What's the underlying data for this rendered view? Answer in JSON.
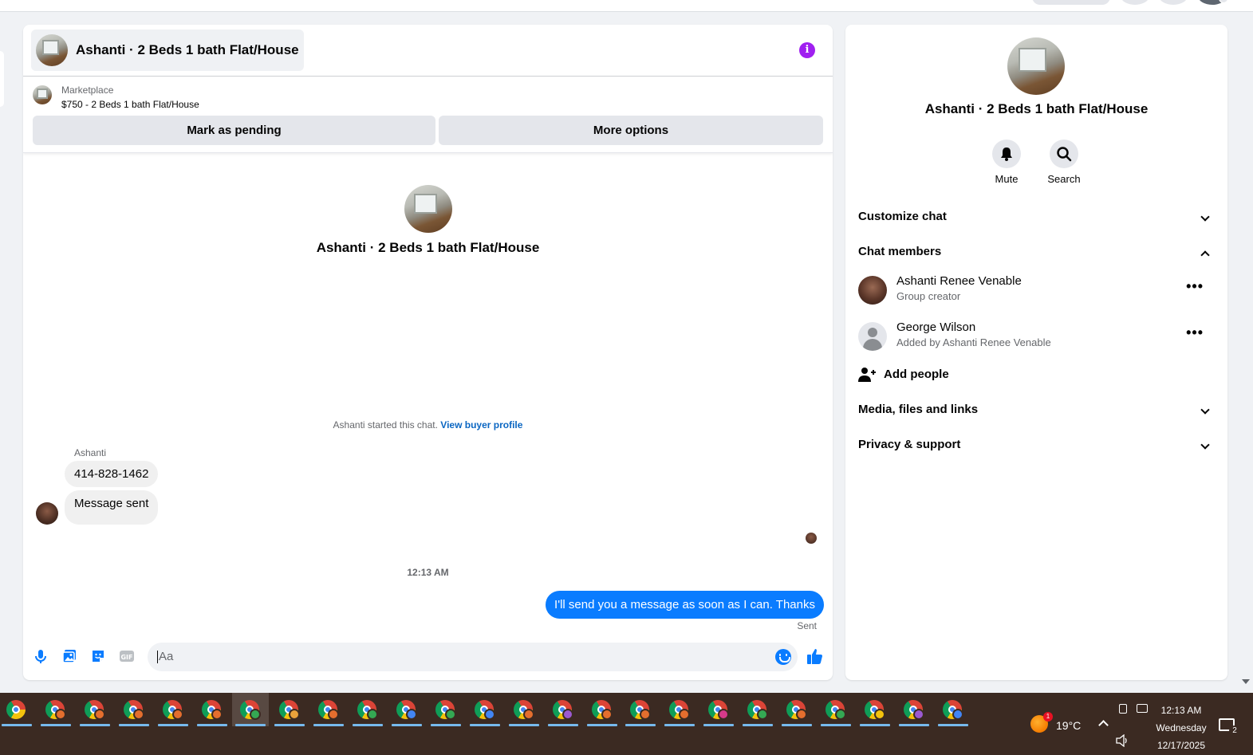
{
  "chat": {
    "title": "Ashanti · 2 Beds 1 bath Flat/House",
    "marketplace": {
      "label": "Marketplace",
      "item": "$750 - 2 Beds 1 bath Flat/House",
      "mark_pending": "Mark as pending",
      "more_options": "More options"
    },
    "intro_title": "Ashanti · 2 Beds 1 bath Flat/House",
    "started_text": "Ashanti started this chat.",
    "view_buyer_profile": "View buyer profile",
    "sender_name": "Ashanti",
    "messages_in": [
      "414-828-1462",
      "Message sent"
    ],
    "timestamp": "12:13 AM",
    "message_out": "I'll send you a message as soon as I can. Thanks",
    "sent_label": "Sent",
    "composer_placeholder": "Aa"
  },
  "info_panel": {
    "title": "Ashanti · 2 Beds 1 bath Flat/House",
    "mute_label": "Mute",
    "search_label": "Search",
    "customize_chat": "Customize chat",
    "chat_members": "Chat members",
    "members": [
      {
        "name": "Ashanti Renee Venable",
        "sub": "Group creator"
      },
      {
        "name": "George Wilson",
        "sub": "Added by Ashanti Renee Venable"
      }
    ],
    "more_dots": "•••",
    "add_people": "Add people",
    "media_files_links": "Media, files and links",
    "privacy_support": "Privacy & support"
  },
  "taskbar": {
    "app_count": 25,
    "profile_colors": [
      "#e46e2e",
      "#e46e2e",
      "#e46e2e",
      "#e46e2e",
      "#e46e2e",
      "#34a853",
      "#e9a23b",
      "#e46e2e",
      "#34a853",
      "#4285f4",
      "#34a853",
      "#4285f4",
      "#e46e2e",
      "#9b59d0",
      "#e46e2e",
      "#e46e2e",
      "#e46e2e",
      "#d63a8a",
      "#34a853",
      "#e46e2e",
      "#34a853",
      "#f4c20d",
      "#9b59d0",
      "#4285f4"
    ],
    "weather_temp": "19°C",
    "weather_badge": "1",
    "clock_time": "12:13 AM",
    "clock_day": "Wednesday",
    "clock_date": "12/17/2025",
    "notification_count": "2"
  },
  "colors": {
    "accent": "#0a7cff",
    "info_icon": "#a020f0",
    "link": "#0a66c2",
    "taskbar": "#3b2a22"
  }
}
